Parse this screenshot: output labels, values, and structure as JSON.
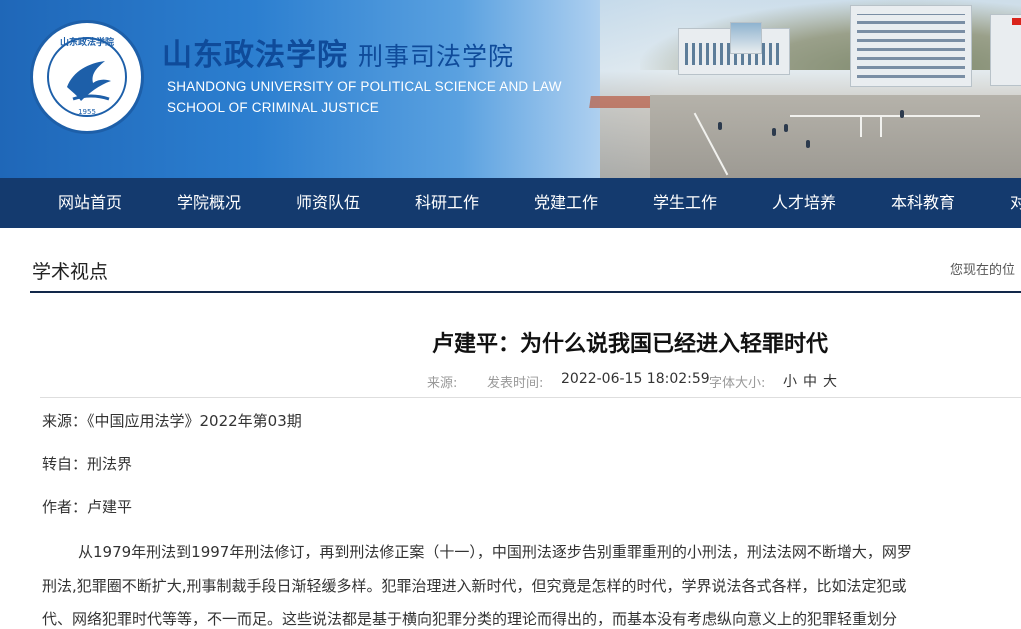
{
  "header": {
    "school_cn": "山东政法学院",
    "dept_cn": "刑事司法学院",
    "school_en": "SHANDONG UNIVERSITY OF POLITICAL SCIENCE AND LAW",
    "dept_en": "SCHOOL OF CRIMINAL JUSTICE",
    "logo_year": "1955",
    "logo_ring_text": "SHANDONG UNIVERSITY OF POLITICAL SCIENCE AND LAW",
    "logo_top_text": "山东政法学院"
  },
  "nav": {
    "items": [
      "网站首页",
      "学院概况",
      "师资队伍",
      "科研工作",
      "党建工作",
      "学生工作",
      "人才培养",
      "本科教育",
      "对"
    ]
  },
  "section": {
    "title": "学术视点",
    "breadcrumb": "您现在的位"
  },
  "article": {
    "title": "卢建平：为什么说我国已经进入轻罪时代",
    "meta": {
      "source_label": "来源:",
      "date_label": "发表时间:",
      "date_value": "2022-06-15 18:02:59",
      "font_label": "字体大小:",
      "font_small": "小",
      "font_medium": "中",
      "font_large": "大"
    },
    "source_line": "来源：《中国应用法学》2022年第03期",
    "repost_line": "转自：刑法界",
    "author_line": "作者：卢建平",
    "body_lines": [
      "从1979年刑法到1997年刑法修订，再到刑法修正案（十一），中国刑法逐步告别重罪重刑的小刑法，刑法法网不断增大，网罗",
      "刑法,犯罪圈不断扩大,刑事制裁手段日渐轻缓多样。犯罪治理进入新时代，但究竟是怎样的时代，学界说法各式各样，比如法定犯或",
      "代、网络犯罪时代等等，不一而足。这些说法都是基于横向犯罪分类的理论而得出的，而基本没有考虑纵向意义上的犯罪轻重划分"
    ]
  },
  "colors": {
    "nav_bg": "#143a6e",
    "brand_blue": "#0f4b9a",
    "rule": "#12284a"
  }
}
